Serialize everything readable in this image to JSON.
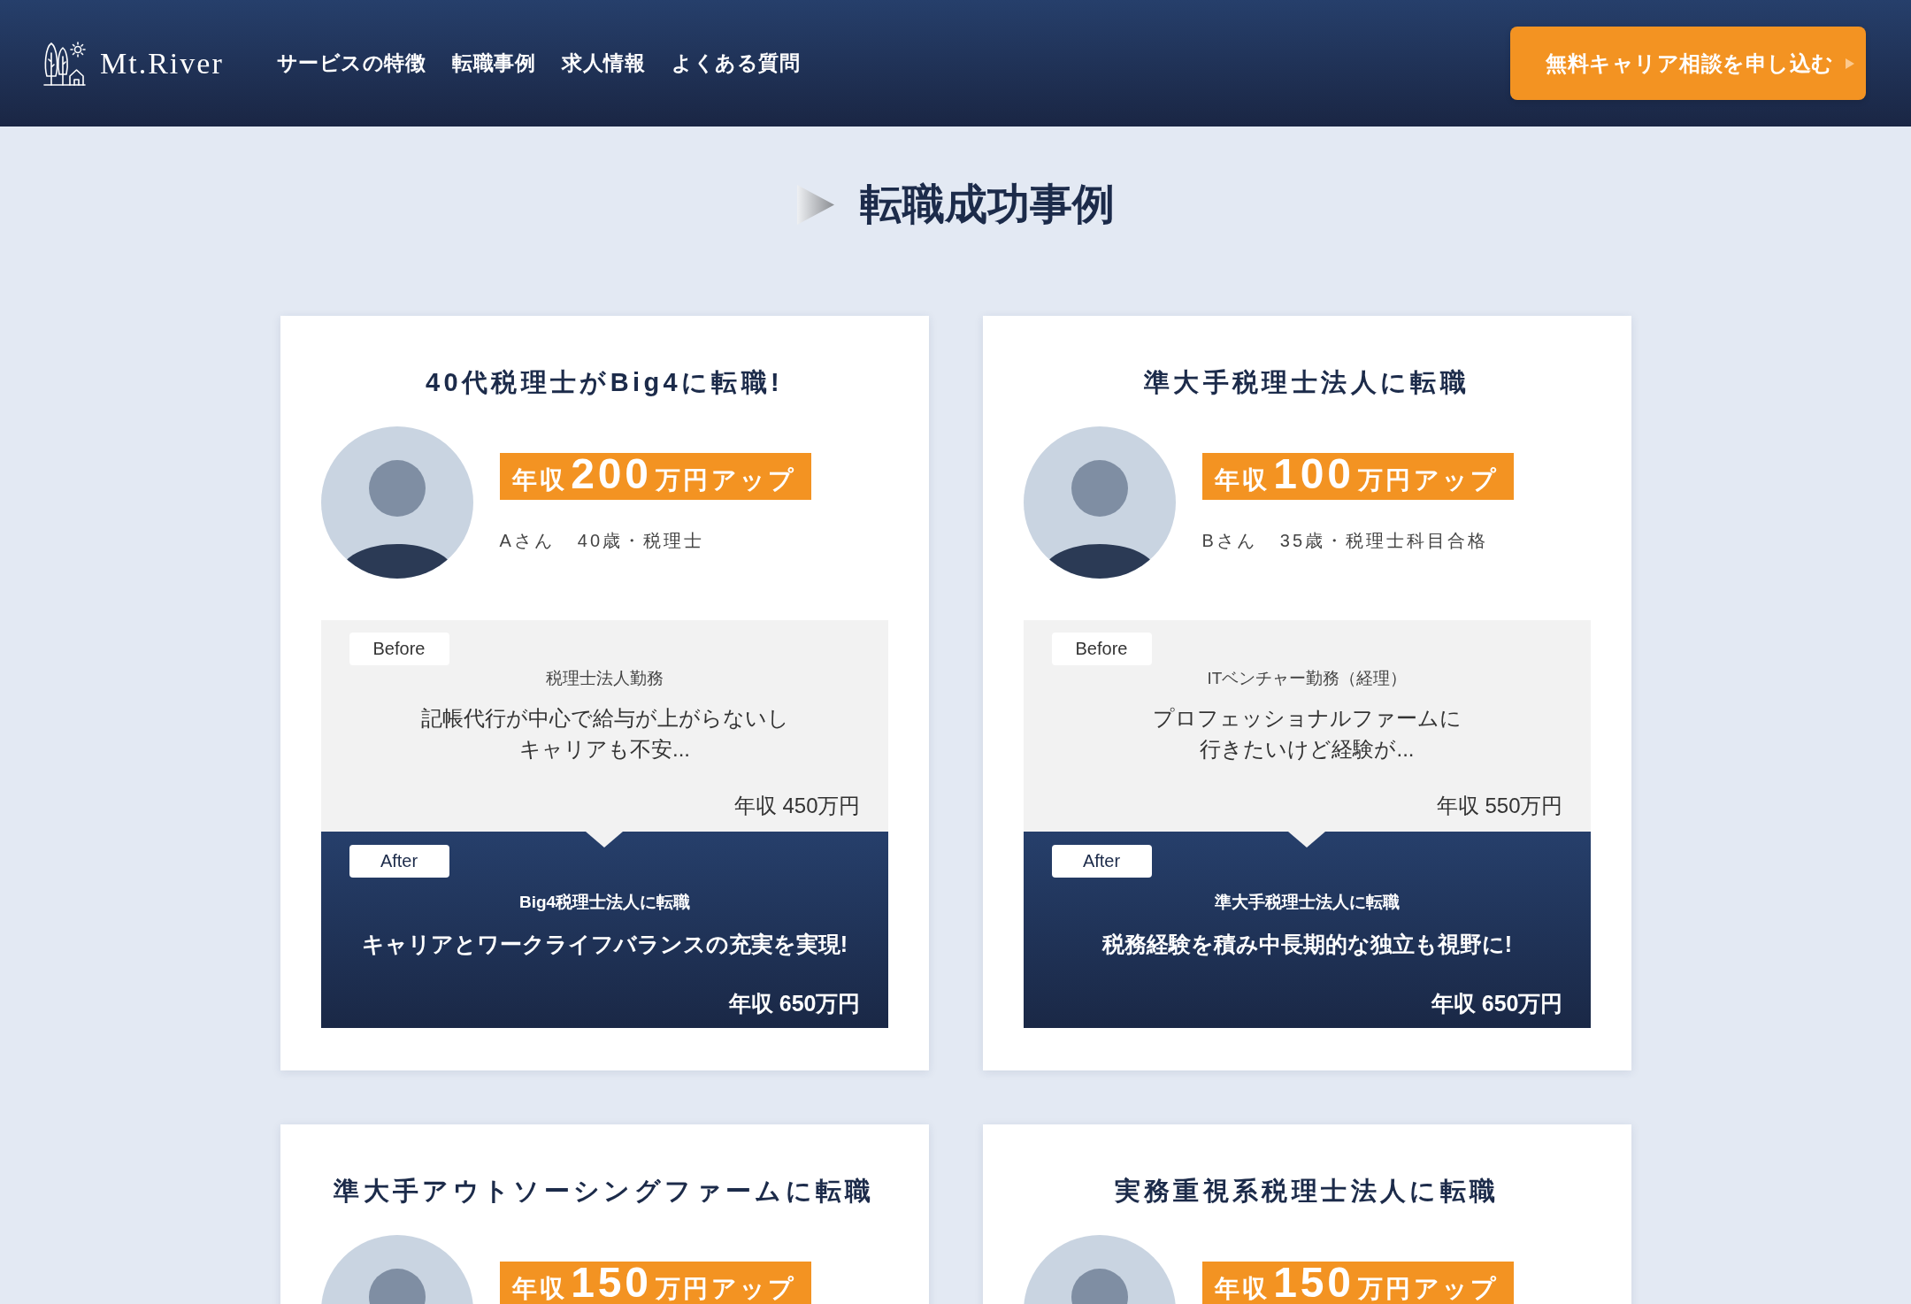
{
  "header": {
    "logo": "Mt.River",
    "nav": [
      "サービスの特徴",
      "転職事例",
      "求人情報",
      "よくある質問"
    ],
    "cta": "無料キャリア相談を申し込む"
  },
  "section": {
    "title": "転職成功事例"
  },
  "cases": [
    {
      "title": "40代税理士がBig4に転職!",
      "raise": {
        "prefix": "年収",
        "amount": "200",
        "suffix": "万円アップ"
      },
      "person": {
        "name": "Aさん",
        "profile": "40歳・税理士"
      },
      "before": {
        "label": "Before",
        "job": "税理士法人勤務",
        "message": [
          "記帳代行が中心で給与が上がらないし",
          "キャリアも不安..."
        ],
        "salary": "年収 450万円"
      },
      "after": {
        "label": "After",
        "job": "Big4税理士法人に転職",
        "message": [
          "キャリアとワークライフバランスの充実を実現!"
        ],
        "salary": "年収 650万円"
      }
    },
    {
      "title": "準大手税理士法人に転職",
      "raise": {
        "prefix": "年収",
        "amount": "100",
        "suffix": "万円アップ"
      },
      "person": {
        "name": "Bさん",
        "profile": "35歳・税理士科目合格"
      },
      "before": {
        "label": "Before",
        "job": "ITベンチャー勤務（経理）",
        "message": [
          "プロフェッショナルファームに",
          "行きたいけど経験が..."
        ],
        "salary": "年収 550万円"
      },
      "after": {
        "label": "After",
        "job": "準大手税理士法人に転職",
        "message": [
          "税務経験を積み中長期的な独立も視野に!"
        ],
        "salary": "年収 650万円"
      }
    },
    {
      "title": "準大手アウトソーシングファームに転職",
      "raise": {
        "prefix": "年収",
        "amount": "150",
        "suffix": "万円アップ"
      }
    },
    {
      "title": "実務重視系税理士法人に転職",
      "raise": {
        "prefix": "年収",
        "amount": "150",
        "suffix": "万円アップ"
      }
    }
  ]
}
